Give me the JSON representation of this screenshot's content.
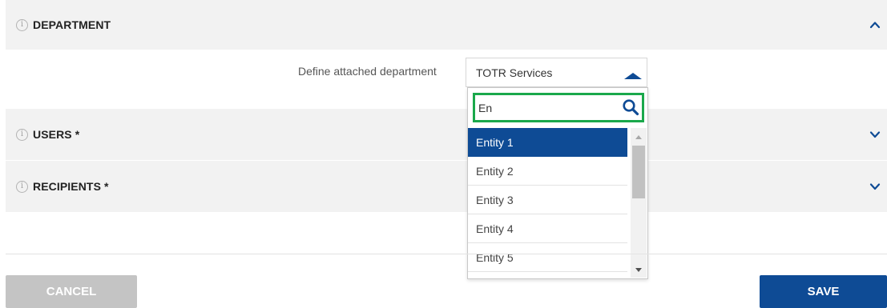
{
  "sections": {
    "department": {
      "title": "DEPARTMENT",
      "expanded": true
    },
    "users": {
      "title": "USERS *",
      "expanded": false
    },
    "recipients": {
      "title": "RECIPIENTS *",
      "expanded": false
    }
  },
  "department_field": {
    "label": "Define attached department",
    "selected_value": "TOTR Services"
  },
  "dropdown": {
    "search_value": "En",
    "options": [
      "Entity 1",
      "Entity 2",
      "Entity 3",
      "Entity 4",
      "Entity 5"
    ],
    "highlighted_option": "Entity 1"
  },
  "actions": {
    "cancel_label": "CANCEL",
    "save_label": "SAVE"
  },
  "icons": {
    "info": "info-icon",
    "expand": "chevron-down-icon",
    "collapse": "chevron-up-icon",
    "search": "search-icon",
    "select_arrow": "caret-up-icon"
  },
  "colors": {
    "accent": "#0e4b95",
    "search_highlight": "#1aa84b",
    "section_bg": "#f2f2f2",
    "cancel_bg": "#c4c4c4"
  }
}
